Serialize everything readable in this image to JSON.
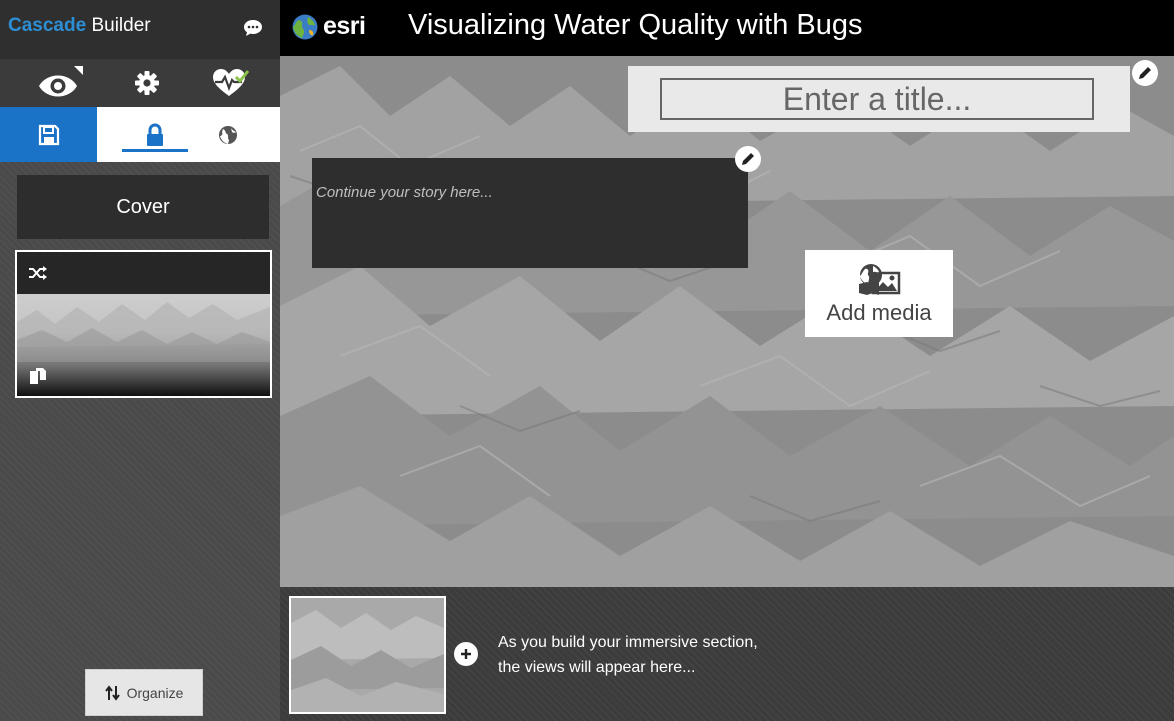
{
  "app": {
    "brand_part1": "Cascade",
    "brand_part2": " Builder",
    "logo_text": "esri",
    "title": "Visualizing Water Quality with Bugs"
  },
  "sidebar": {
    "toolbar": [
      "eye-icon",
      "gear-icon",
      "heartbeat-check-icon"
    ],
    "tabs": [
      "save-icon",
      "lock-icon",
      "globe-icon"
    ],
    "cover_label": "Cover",
    "organize_label": "Organize"
  },
  "canvas": {
    "title_placeholder": "Enter a title...",
    "story_placeholder": "Continue your story here...",
    "add_media_label": "Add media"
  },
  "bottom": {
    "views_message_line1": "As you build your immersive section,",
    "views_message_line2": "the views will appear here..."
  },
  "colors": {
    "accent": "#1a73c6",
    "brand_blue": "#2c8fd6",
    "health_check": "#8bc34a"
  }
}
